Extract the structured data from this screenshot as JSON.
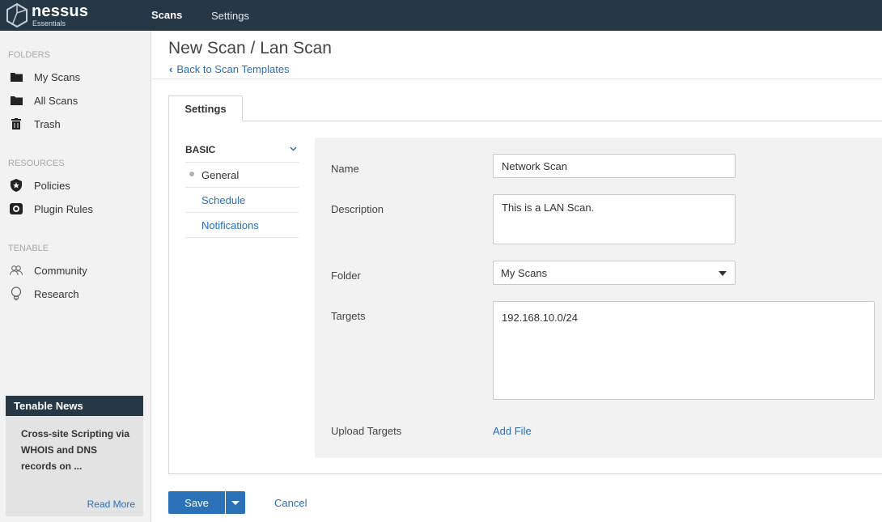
{
  "app": {
    "logo_name": "nessus",
    "logo_sub": "Essentials"
  },
  "topnav": {
    "scans": "Scans",
    "settings": "Settings"
  },
  "sidebar": {
    "folders_header": "FOLDERS",
    "folders": [
      {
        "label": "My Scans",
        "icon": "folder-icon"
      },
      {
        "label": "All Scans",
        "icon": "folder-icon"
      },
      {
        "label": "Trash",
        "icon": "trash-icon"
      }
    ],
    "resources_header": "RESOURCES",
    "resources": [
      {
        "label": "Policies",
        "icon": "shield-star-icon"
      },
      {
        "label": "Plugin Rules",
        "icon": "plugin-icon"
      }
    ],
    "tenable_header": "TENABLE",
    "tenable": [
      {
        "label": "Community",
        "icon": "community-icon"
      },
      {
        "label": "Research",
        "icon": "lightbulb-icon"
      }
    ]
  },
  "news": {
    "title": "Tenable News",
    "headline": "Cross-site Scripting via WHOIS and DNS records on ...",
    "read_more": "Read More"
  },
  "page": {
    "title": "New Scan / Lan Scan",
    "back_link": "Back to Scan Templates",
    "tab": "Settings"
  },
  "subnav": {
    "section": "BASIC",
    "items": [
      "General",
      "Schedule",
      "Notifications"
    ],
    "active": "General"
  },
  "form": {
    "name_label": "Name",
    "name_value": "Network Scan",
    "description_label": "Description",
    "description_value": "This is a LAN Scan.",
    "folder_label": "Folder",
    "folder_value": "My Scans",
    "targets_label": "Targets",
    "targets_value": "192.168.10.0/24",
    "upload_label": "Upload Targets",
    "upload_link": "Add File"
  },
  "actions": {
    "save": "Save",
    "cancel": "Cancel"
  },
  "colors": {
    "topbar": "#263746",
    "link": "#2a6ebb",
    "button": "#2a71b8"
  }
}
